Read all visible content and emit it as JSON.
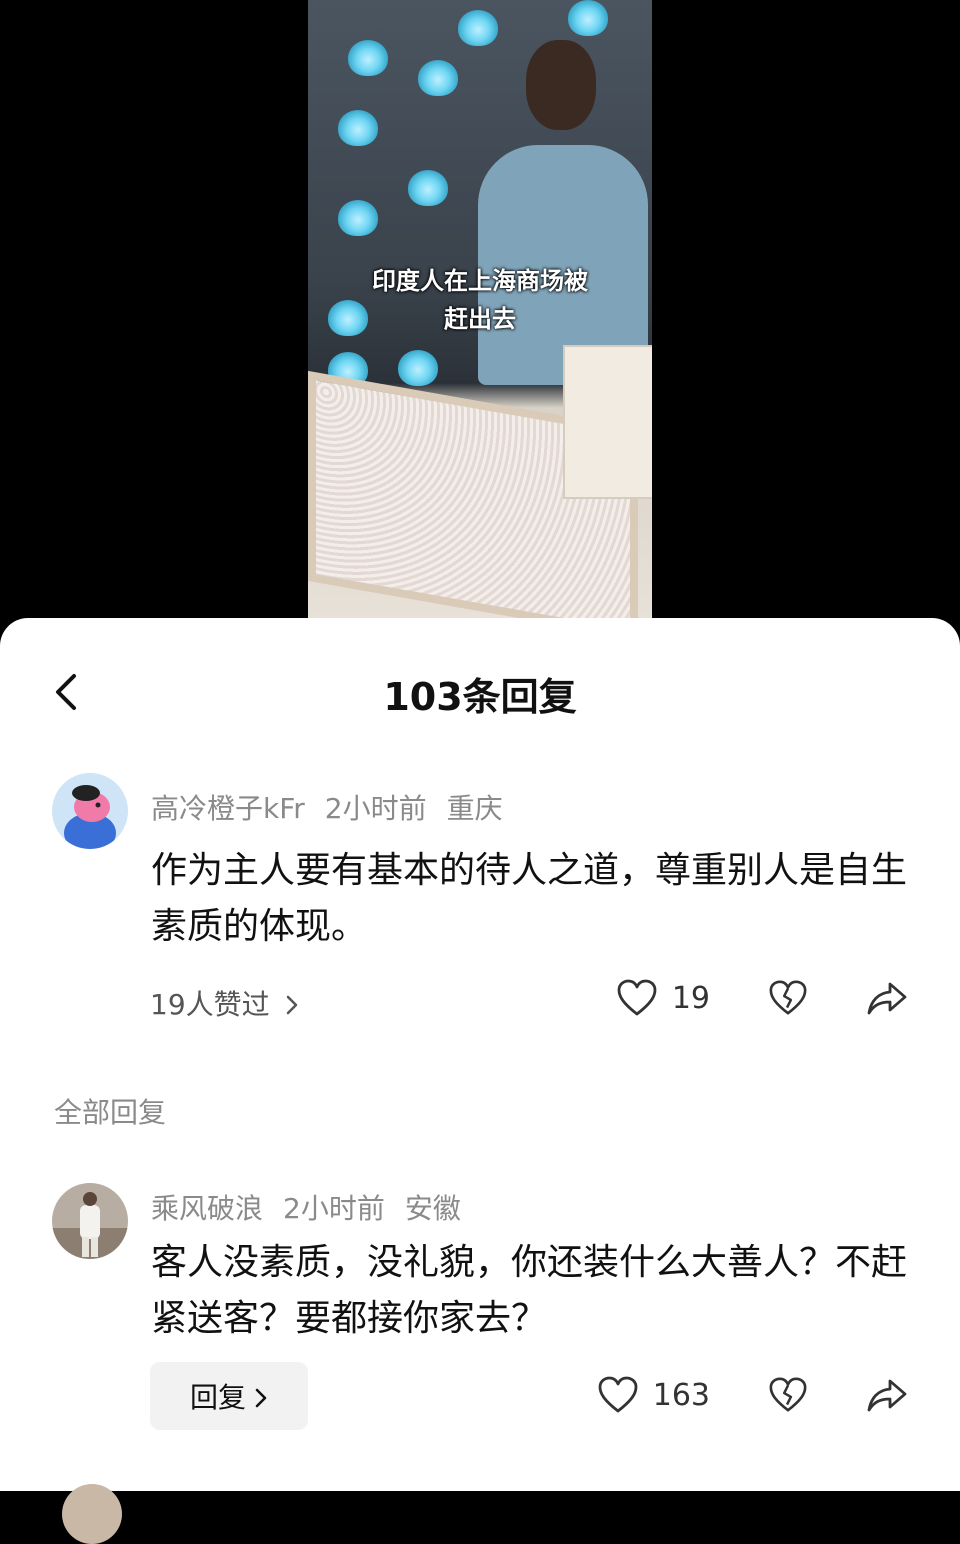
{
  "video": {
    "caption_line1": "印度人在上海商场被",
    "caption_line2": "赶出去"
  },
  "sheet": {
    "title": "103条回复",
    "back_icon": "chevron-left-icon"
  },
  "main_comment": {
    "username": "高冷橙子kFr",
    "time": "2小时前",
    "location": "重庆",
    "text": "作为主人要有基本的待人之道，尊重别人是自生素质的体现。",
    "liked_by": "19人赞过",
    "likes": "19"
  },
  "section_label": "全部回复",
  "reply_comment": {
    "username": "乘风破浪",
    "time": "2小时前",
    "location": "安徽",
    "text": "客人没素质，没礼貌，你还装什么大善人？不赶紧送客？要都接你家去？",
    "reply_button": "回复",
    "likes": "163"
  },
  "colors": {
    "accent_text": "#111111",
    "meta_text": "#8a8a8a",
    "button_bg": "#f2f2f2"
  }
}
